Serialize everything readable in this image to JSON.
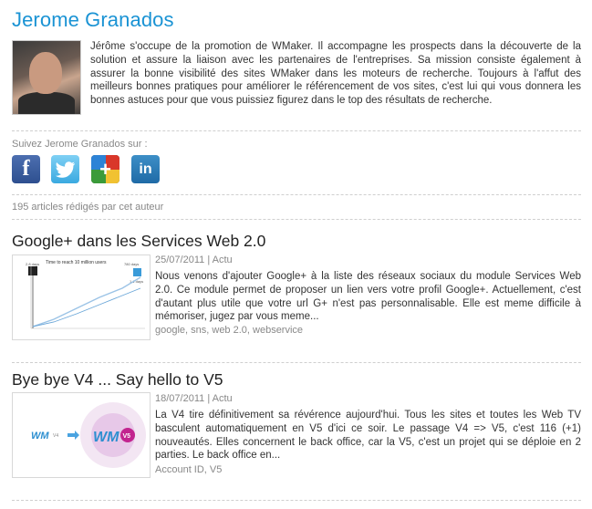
{
  "author": {
    "name": "Jerome Granados",
    "bio": "Jérôme s'occupe de la promotion de WMaker. Il accompagne les prospects dans la découverte de la solution et assure la liaison avec les partenaires de l'entreprises. Sa mission consiste également à assurer la bonne visibilité des sites WMaker dans les moteurs de recherche. Toujours à l'affut des meilleurs bonnes pratiques pour améliorer le référencement de vos sites, c'est lui qui vous donnera les bonnes astuces pour que vous puissiez figurez dans le top des résultats de recherche."
  },
  "follow": {
    "label": "Suivez Jerome Granados sur :",
    "networks": [
      {
        "name": "facebook",
        "icon": "facebook-icon",
        "glyph": "f"
      },
      {
        "name": "twitter",
        "icon": "twitter-icon"
      },
      {
        "name": "google-plus",
        "icon": "google-plus-icon",
        "glyph": "+"
      },
      {
        "name": "linkedin",
        "icon": "linkedin-icon",
        "glyph": "in"
      }
    ]
  },
  "article_count": "195 articles rédigés par cet auteur",
  "articles": [
    {
      "title": "Google+ dans les Services Web 2.0",
      "date": "25/07/2011",
      "category": "Actu",
      "excerpt": "Nous venons d'ajouter Google+ à la liste des réseaux sociaux du module Services Web 2.0. Ce module permet de proposer un lien vers votre profil Google+. Actuellement, c'est d'autant plus utile que votre url G+ n'est pas personnalisable. Elle est meme difficile à mémoriser, jugez par vous meme...",
      "tags": "google, sns, web 2.0, webservice",
      "thumb_title": "Time to reach 10 million users",
      "thumb_labels": [
        "2.8 days",
        "780 days",
        "1.1 days"
      ]
    },
    {
      "title": "Bye bye V4 ... Say hello to V5",
      "date": "18/07/2011",
      "category": "Actu",
      "excerpt": "La V4 tire définitivement sa révérence aujourd'hui. Tous les sites et toutes les Web TV basculent automatiquement en V5 d'ici ce soir. Le passage V4 => V5, c'est 116 (+1) nouveautés. Elles concernent le back office, car la V5, c'est un projet qui se déploie en 2 parties. Le back office en...",
      "tags": "Account ID, V5",
      "thumb_logo_old": "WM",
      "thumb_logo_old_tag": "V4",
      "thumb_logo_new": "WM",
      "thumb_logo_new_tag": "V5"
    }
  ],
  "colors": {
    "title_blue": "#1a93d4",
    "facebook": "#3b5998",
    "twitter": "#4ab3e8",
    "linkedin": "#2a77b6"
  }
}
